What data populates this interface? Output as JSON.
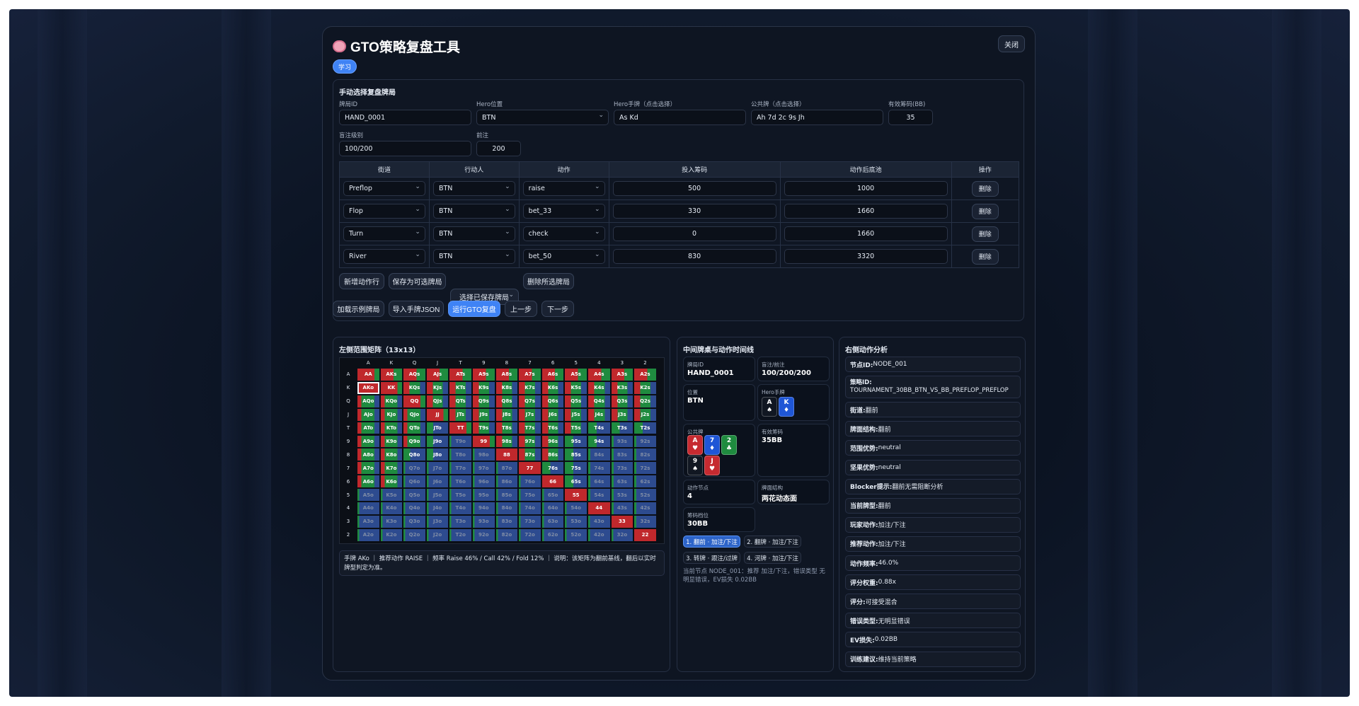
{
  "app": {
    "title": "GTO策略复盘工具",
    "close_label": "关闭",
    "mode_label": "学习"
  },
  "colors": {
    "accent": "#3f83f5",
    "raise": "#c0282c",
    "call": "#1f8b3f",
    "fold": "#2d4b8f"
  },
  "manual": {
    "heading": "手动选择复盘牌局",
    "hand_id": {
      "label": "牌局ID",
      "value": "HAND_0001"
    },
    "hero_pos": {
      "label": "Hero位置",
      "value": "BTN"
    },
    "hero_cards": {
      "label": "Hero手牌（点击选择）",
      "value": "As Kd"
    },
    "board": {
      "label": "公共牌（点击选择）",
      "value": "Ah 7d 2c 9s Jh"
    },
    "stack": {
      "label": "有效筹码(BB)",
      "value": "35"
    },
    "blinds": {
      "label": "盲注级别",
      "value": "100/200"
    },
    "ante": {
      "label": "前注",
      "value": "200"
    }
  },
  "actions_table": {
    "headers": [
      "街道",
      "行动人",
      "动作",
      "投入筹码",
      "动作后底池",
      "操作"
    ],
    "rows": [
      {
        "street": "Preflop",
        "actor": "BTN",
        "action": "raise",
        "amount": "500",
        "pot": "1000",
        "op": "删除"
      },
      {
        "street": "Flop",
        "actor": "BTN",
        "action": "bet_33",
        "amount": "330",
        "pot": "1660",
        "op": "删除"
      },
      {
        "street": "Turn",
        "actor": "BTN",
        "action": "check",
        "amount": "0",
        "pot": "1660",
        "op": "删除"
      },
      {
        "street": "River",
        "actor": "BTN",
        "action": "bet_50",
        "amount": "830",
        "pot": "3320",
        "op": "删除"
      }
    ]
  },
  "buttons": {
    "add_row": "新增动作行",
    "save": "保存为可选牌局",
    "choose_saved": "选择已保存牌局",
    "delete_selected": "删除所选牌局",
    "load_example": "加载示例牌局",
    "import_json": "导入手牌JSON",
    "run_gto": "运行GTO复盘",
    "prev": "上一步",
    "next": "下一步"
  },
  "matrix": {
    "heading": "左侧范围矩阵（13x13）",
    "ranks": [
      "A",
      "K",
      "Q",
      "J",
      "T",
      "9",
      "8",
      "7",
      "6",
      "5",
      "4",
      "3",
      "2"
    ],
    "selected_hand": "AKo",
    "info": "手牌 AKo ｜ 推荐动作 RAISE ｜ 频率 Raise 46% / Call 42% / Fold 12% ｜ 说明：该矩阵为翻前基线，翻后以实时牌型判定为准。"
  },
  "middle": {
    "heading": "中间牌桌与动作时间线",
    "hand_id": {
      "label": "牌局ID",
      "value": "HAND_0001"
    },
    "blinds": {
      "label": "盲注/前注",
      "value": "100/200/200"
    },
    "position": {
      "label": "位置",
      "value": "BTN"
    },
    "hero_cards_label": "Hero手牌",
    "hero_cards": [
      {
        "rank": "A",
        "suit": "♠",
        "color": "#111722"
      },
      {
        "rank": "K",
        "suit": "♦",
        "color": "#1f56d6"
      }
    ],
    "board_label": "公共牌",
    "board": [
      {
        "rank": "A",
        "suit": "♥",
        "color": "#c62a30"
      },
      {
        "rank": "7",
        "suit": "♦",
        "color": "#1f56d6"
      },
      {
        "rank": "2",
        "suit": "♣",
        "color": "#1f8b3f"
      },
      {
        "rank": "9",
        "suit": "♠",
        "color": "#111722"
      },
      {
        "rank": "J",
        "suit": "♥",
        "color": "#c62a30"
      }
    ],
    "stack": {
      "label": "有效筹码",
      "value": "35BB"
    },
    "node": {
      "label": "动作节点",
      "value": "4"
    },
    "texture": {
      "label": "牌面结构",
      "value": "两花动态面"
    },
    "stack_bucket": {
      "label": "筹码档位",
      "value": "30BB"
    },
    "timeline": [
      "1. 翻前 · 加注/下注",
      "2. 翻牌 · 加注/下注",
      "3. 转牌 · 跟注/过牌",
      "4. 河牌 · 加注/下注"
    ],
    "current_note": "当前节点 NODE_001：推荐 加注/下注，错误类型 无明显错误，EV损失 0.02BB"
  },
  "right": {
    "heading": "右侧动作分析",
    "rows": [
      {
        "k": "节点ID: ",
        "v": "NODE_001"
      },
      {
        "k": "策略ID: ",
        "v": "TOURNAMENT_30BB_BTN_VS_BB_PREFLOP_PREFLOP"
      },
      {
        "k": "街道: ",
        "v": "翻前"
      },
      {
        "k": "牌面结构: ",
        "v": "翻前"
      },
      {
        "k": "范围优势: ",
        "v": "neutral"
      },
      {
        "k": "坚果优势: ",
        "v": "neutral"
      },
      {
        "k": "Blocker提示: ",
        "v": "翻前无需阻断分析"
      },
      {
        "k": "当前牌型: ",
        "v": "翻前"
      },
      {
        "k": "玩家动作: ",
        "v": "加注/下注"
      },
      {
        "k": "推荐动作: ",
        "v": "加注/下注"
      },
      {
        "k": "动作频率: ",
        "v": "46.0%"
      },
      {
        "k": "评分权重: ",
        "v": "0.88x"
      },
      {
        "k": "评分: ",
        "v": "可接受混合"
      },
      {
        "k": "错误类型: ",
        "v": "无明显错误"
      },
      {
        "k": "EV损失: ",
        "v": "0.02BB"
      },
      {
        "k": "训练建议: ",
        "v": "维持当前策略"
      }
    ]
  }
}
